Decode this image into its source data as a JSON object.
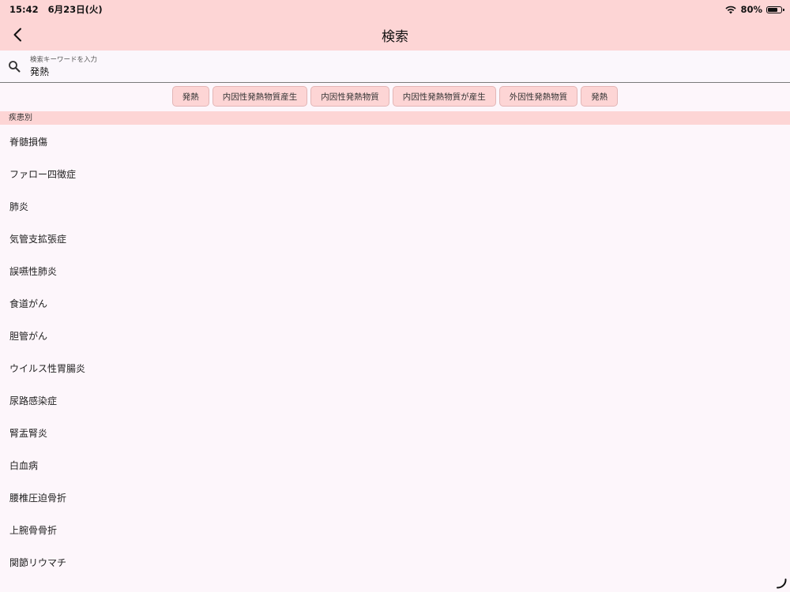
{
  "status_bar": {
    "time": "15:42",
    "date": "6月23日(火)",
    "battery": "80%",
    "battery_level": 0.8
  },
  "header": {
    "title": "検索",
    "back_icon": "chevron-left-icon"
  },
  "search": {
    "label": "検索キーワードを入力",
    "value": "発熱",
    "icon": "search-icon"
  },
  "chips": [
    "発熱",
    "内因性発熱物質産生",
    "内因性発熱物質",
    "内因性発熱物質が産生",
    "外因性発熱物質",
    "発熱"
  ],
  "section": {
    "title": "疾患別"
  },
  "results": [
    "脊髄損傷",
    "ファロー四徴症",
    "肺炎",
    "気管支拡張症",
    "誤嚥性肺炎",
    "食道がん",
    "胆管がん",
    "ウイルス性胃腸炎",
    "尿路感染症",
    "腎盂腎炎",
    "白血病",
    "腰椎圧迫骨折",
    "上腕骨骨折",
    "関節リウマチ"
  ],
  "colors": {
    "accent": "#fdd5d5",
    "background": "#fdf6fb"
  }
}
